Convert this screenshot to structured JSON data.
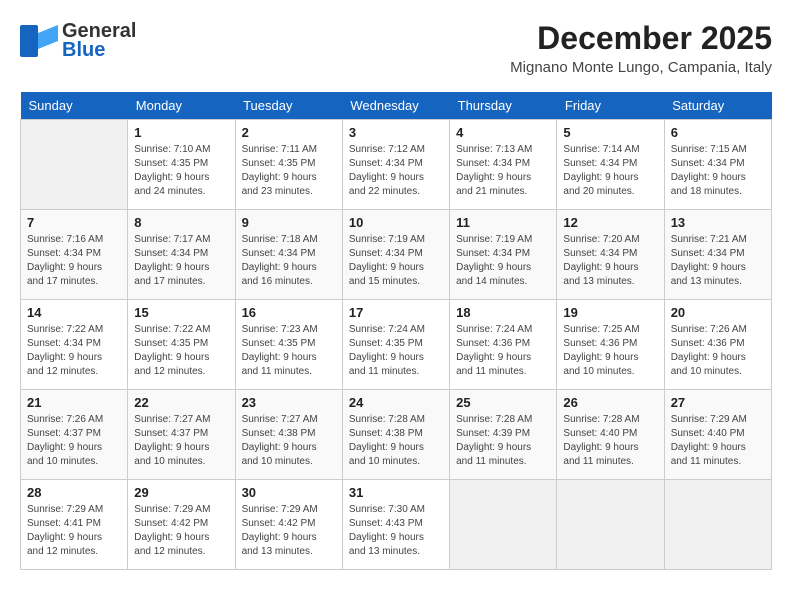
{
  "header": {
    "logo_line1": "General",
    "logo_line2": "Blue",
    "month_title": "December 2025",
    "location": "Mignano Monte Lungo, Campania, Italy"
  },
  "days_of_week": [
    "Sunday",
    "Monday",
    "Tuesday",
    "Wednesday",
    "Thursday",
    "Friday",
    "Saturday"
  ],
  "weeks": [
    [
      {
        "day": "",
        "sunrise": "",
        "sunset": "",
        "daylight": ""
      },
      {
        "day": "1",
        "sunrise": "Sunrise: 7:10 AM",
        "sunset": "Sunset: 4:35 PM",
        "daylight": "Daylight: 9 hours and 24 minutes."
      },
      {
        "day": "2",
        "sunrise": "Sunrise: 7:11 AM",
        "sunset": "Sunset: 4:35 PM",
        "daylight": "Daylight: 9 hours and 23 minutes."
      },
      {
        "day": "3",
        "sunrise": "Sunrise: 7:12 AM",
        "sunset": "Sunset: 4:34 PM",
        "daylight": "Daylight: 9 hours and 22 minutes."
      },
      {
        "day": "4",
        "sunrise": "Sunrise: 7:13 AM",
        "sunset": "Sunset: 4:34 PM",
        "daylight": "Daylight: 9 hours and 21 minutes."
      },
      {
        "day": "5",
        "sunrise": "Sunrise: 7:14 AM",
        "sunset": "Sunset: 4:34 PM",
        "daylight": "Daylight: 9 hours and 20 minutes."
      },
      {
        "day": "6",
        "sunrise": "Sunrise: 7:15 AM",
        "sunset": "Sunset: 4:34 PM",
        "daylight": "Daylight: 9 hours and 18 minutes."
      }
    ],
    [
      {
        "day": "7",
        "sunrise": "Sunrise: 7:16 AM",
        "sunset": "Sunset: 4:34 PM",
        "daylight": "Daylight: 9 hours and 17 minutes."
      },
      {
        "day": "8",
        "sunrise": "Sunrise: 7:17 AM",
        "sunset": "Sunset: 4:34 PM",
        "daylight": "Daylight: 9 hours and 17 minutes."
      },
      {
        "day": "9",
        "sunrise": "Sunrise: 7:18 AM",
        "sunset": "Sunset: 4:34 PM",
        "daylight": "Daylight: 9 hours and 16 minutes."
      },
      {
        "day": "10",
        "sunrise": "Sunrise: 7:19 AM",
        "sunset": "Sunset: 4:34 PM",
        "daylight": "Daylight: 9 hours and 15 minutes."
      },
      {
        "day": "11",
        "sunrise": "Sunrise: 7:19 AM",
        "sunset": "Sunset: 4:34 PM",
        "daylight": "Daylight: 9 hours and 14 minutes."
      },
      {
        "day": "12",
        "sunrise": "Sunrise: 7:20 AM",
        "sunset": "Sunset: 4:34 PM",
        "daylight": "Daylight: 9 hours and 13 minutes."
      },
      {
        "day": "13",
        "sunrise": "Sunrise: 7:21 AM",
        "sunset": "Sunset: 4:34 PM",
        "daylight": "Daylight: 9 hours and 13 minutes."
      }
    ],
    [
      {
        "day": "14",
        "sunrise": "Sunrise: 7:22 AM",
        "sunset": "Sunset: 4:34 PM",
        "daylight": "Daylight: 9 hours and 12 minutes."
      },
      {
        "day": "15",
        "sunrise": "Sunrise: 7:22 AM",
        "sunset": "Sunset: 4:35 PM",
        "daylight": "Daylight: 9 hours and 12 minutes."
      },
      {
        "day": "16",
        "sunrise": "Sunrise: 7:23 AM",
        "sunset": "Sunset: 4:35 PM",
        "daylight": "Daylight: 9 hours and 11 minutes."
      },
      {
        "day": "17",
        "sunrise": "Sunrise: 7:24 AM",
        "sunset": "Sunset: 4:35 PM",
        "daylight": "Daylight: 9 hours and 11 minutes."
      },
      {
        "day": "18",
        "sunrise": "Sunrise: 7:24 AM",
        "sunset": "Sunset: 4:36 PM",
        "daylight": "Daylight: 9 hours and 11 minutes."
      },
      {
        "day": "19",
        "sunrise": "Sunrise: 7:25 AM",
        "sunset": "Sunset: 4:36 PM",
        "daylight": "Daylight: 9 hours and 10 minutes."
      },
      {
        "day": "20",
        "sunrise": "Sunrise: 7:26 AM",
        "sunset": "Sunset: 4:36 PM",
        "daylight": "Daylight: 9 hours and 10 minutes."
      }
    ],
    [
      {
        "day": "21",
        "sunrise": "Sunrise: 7:26 AM",
        "sunset": "Sunset: 4:37 PM",
        "daylight": "Daylight: 9 hours and 10 minutes."
      },
      {
        "day": "22",
        "sunrise": "Sunrise: 7:27 AM",
        "sunset": "Sunset: 4:37 PM",
        "daylight": "Daylight: 9 hours and 10 minutes."
      },
      {
        "day": "23",
        "sunrise": "Sunrise: 7:27 AM",
        "sunset": "Sunset: 4:38 PM",
        "daylight": "Daylight: 9 hours and 10 minutes."
      },
      {
        "day": "24",
        "sunrise": "Sunrise: 7:28 AM",
        "sunset": "Sunset: 4:38 PM",
        "daylight": "Daylight: 9 hours and 10 minutes."
      },
      {
        "day": "25",
        "sunrise": "Sunrise: 7:28 AM",
        "sunset": "Sunset: 4:39 PM",
        "daylight": "Daylight: 9 hours and 11 minutes."
      },
      {
        "day": "26",
        "sunrise": "Sunrise: 7:28 AM",
        "sunset": "Sunset: 4:40 PM",
        "daylight": "Daylight: 9 hours and 11 minutes."
      },
      {
        "day": "27",
        "sunrise": "Sunrise: 7:29 AM",
        "sunset": "Sunset: 4:40 PM",
        "daylight": "Daylight: 9 hours and 11 minutes."
      }
    ],
    [
      {
        "day": "28",
        "sunrise": "Sunrise: 7:29 AM",
        "sunset": "Sunset: 4:41 PM",
        "daylight": "Daylight: 9 hours and 12 minutes."
      },
      {
        "day": "29",
        "sunrise": "Sunrise: 7:29 AM",
        "sunset": "Sunset: 4:42 PM",
        "daylight": "Daylight: 9 hours and 12 minutes."
      },
      {
        "day": "30",
        "sunrise": "Sunrise: 7:29 AM",
        "sunset": "Sunset: 4:42 PM",
        "daylight": "Daylight: 9 hours and 13 minutes."
      },
      {
        "day": "31",
        "sunrise": "Sunrise: 7:30 AM",
        "sunset": "Sunset: 4:43 PM",
        "daylight": "Daylight: 9 hours and 13 minutes."
      },
      {
        "day": "",
        "sunrise": "",
        "sunset": "",
        "daylight": ""
      },
      {
        "day": "",
        "sunrise": "",
        "sunset": "",
        "daylight": ""
      },
      {
        "day": "",
        "sunrise": "",
        "sunset": "",
        "daylight": ""
      }
    ]
  ]
}
